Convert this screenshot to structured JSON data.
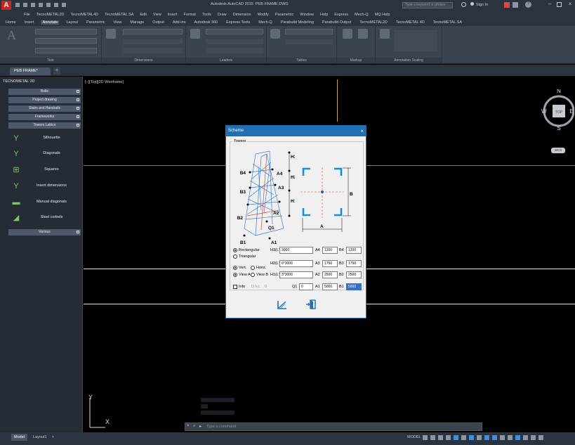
{
  "titlebar": {
    "app_title": "Autodesk AutoCAD 2015",
    "file_name": "PEB FRAME.DWG",
    "search_placeholder": "Type a keyword or phrase",
    "sign_in": "Sign In"
  },
  "menu": [
    "File",
    "TecnoMETAL2D",
    "TecnoMETAL4D",
    "TecnoMETAL SA",
    "Edit",
    "View",
    "Insert",
    "Format",
    "Tools",
    "Draw",
    "Dimension",
    "Modify",
    "Parametric",
    "Window",
    "Help",
    "Express",
    "Mech-Q",
    "MQ Help"
  ],
  "ribbon_tabs": [
    "Home",
    "Insert",
    "Annotate",
    "Layout",
    "Parametric",
    "View",
    "Manage",
    "Output",
    "Add-ins",
    "Autodesk 360",
    "Express Tools",
    "Mech-Q",
    "Parabuild Modeling",
    "Parabuild Output",
    "TecnoMETAL2D",
    "TecnoMETAL 4D",
    "TecnoMETAL SA"
  ],
  "ribbon_active_tab": "Annotate",
  "ribbon_panels": [
    "Text",
    "Dimensions",
    "Leaders",
    "Tables",
    "Markup",
    "Annotation Scaling"
  ],
  "file_tab": "PEB FRAME*",
  "palette": {
    "title": "TECNOMETAL 2D",
    "sections": [
      "Bolts",
      "Project drawing",
      "Stairs and Handrails",
      "Frameworks",
      "Towers Lattice"
    ],
    "items": [
      "Silhouette",
      "Diagonals",
      "Squares",
      "Insert dimensions",
      "Manual diagonals",
      "Steel corbels"
    ],
    "bottom_section": "Various"
  },
  "viewport": {
    "label": "[–][Top][2D Wireframe]",
    "ucs_x": "X",
    "ucs_y": "Y"
  },
  "navcube": {
    "n": "N",
    "s": "S",
    "w": "W",
    "e": "E",
    "top": "TOP",
    "wcs": "WCS"
  },
  "dialog": {
    "title": "Scheme",
    "group_title": "Towers",
    "tower_labels": {
      "h3": "H3",
      "h2": "H2",
      "h1": "H1",
      "b4": "B4",
      "a4": "A4",
      "b3": "B3",
      "a3": "A3",
      "b2": "B2",
      "a2": "A2",
      "q1": "Q1",
      "b1": "B1",
      "a1": "A1"
    },
    "plan_labels": {
      "a": "A",
      "b": "B"
    },
    "shape_options": [
      "Rectangular",
      "Triangular"
    ],
    "shape_selected": "Rectangular",
    "orientation_options": [
      "Vert.",
      "Horiz."
    ],
    "view_options": [
      "View A",
      "View B"
    ],
    "info_label": "Info",
    "info_dim_label": "D.h.t.",
    "info_dim_value": "0",
    "fields": {
      "h3_label": "H3(L')",
      "h3_value": "3000",
      "h2_label": "H2(L')",
      "h2_value": "6*3000",
      "h1_label": "H1(L')",
      "h1_value": "3*3000",
      "q1_label": "Q1",
      "q1_value": "0",
      "a4_label": "A4",
      "a4_value": "1200",
      "b4_label": "B4",
      "b4_value": "1200",
      "a3_label": "A3",
      "a3_value": "1750",
      "b3_label": "B3",
      "b3_value": "1750",
      "a2_label": "A2",
      "a2_value": "2500",
      "b2_label": "B2",
      "b2_value": "2500",
      "a1_label": "A1",
      "a1_value": "5000",
      "b1_label": "B1",
      "b1_value": "5000"
    }
  },
  "command_line": {
    "placeholder": "Type a command"
  },
  "status": {
    "model_tab": "Model",
    "layout_tab": "Layout1",
    "add_tab": "+",
    "model_label": "MODEL"
  },
  "colors": {
    "accent": "#1f6fb5",
    "autocad_red": "#c5281c",
    "cyan_line": "#2a9fb3",
    "tower_blue": "#3a7fd5",
    "tower_red": "#e0452a"
  }
}
